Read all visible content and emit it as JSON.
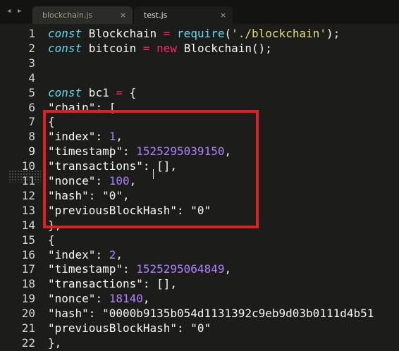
{
  "tabs": [
    {
      "label": "blockchain.js",
      "active": false,
      "close_icon": "×"
    },
    {
      "label": "test.js",
      "active": true,
      "close_icon": "×"
    }
  ],
  "nav": {
    "left_arrow": "◀",
    "right_arrow": "▶"
  },
  "line_numbers": [
    "1",
    "2",
    "3",
    "4",
    "5",
    "6",
    "7",
    "8",
    "9",
    "10",
    "11",
    "12",
    "13",
    "14",
    "15",
    "16",
    "17",
    "18",
    "19",
    "20",
    "21",
    "22"
  ],
  "active_line": 9,
  "code": {
    "l1": {
      "kw": "const",
      "name": " Blockchain ",
      "op": "=",
      "sp": " ",
      "fn": "require",
      "open": "(",
      "str": "'./blockchain'",
      "close": ");"
    },
    "l2": {
      "kw": "const",
      "name": " bitcoin ",
      "op": "=",
      "sp": " ",
      "new": "new",
      "rest": " Blockchain();"
    },
    "l5": {
      "kw": "const",
      "name": " bc1 ",
      "op": "=",
      "rest": " {"
    },
    "l6": {
      "key": "\"chain\"",
      "rest": ": ["
    },
    "l7": {
      "text": "{"
    },
    "l8": {
      "key": "\"index\"",
      "sep": ": ",
      "val": "1",
      "end": ","
    },
    "l9": {
      "key": "\"timestamp\"",
      "sep": ": ",
      "val": "1525295039150",
      "end": ","
    },
    "l10": {
      "key": "\"transactions\"",
      "rest": ": [],"
    },
    "l11": {
      "key": "\"nonce\"",
      "sep": ": ",
      "val": "100",
      "end": ","
    },
    "l12": {
      "key": "\"hash\"",
      "sep": ": ",
      "str": "\"0\"",
      "end": ","
    },
    "l13": {
      "key": "\"previousBlockHash\"",
      "sep": ": ",
      "str": "\"0\""
    },
    "l14": {
      "text": "},"
    },
    "l15": {
      "text": "{"
    },
    "l16": {
      "key": "\"index\"",
      "sep": ": ",
      "val": "2",
      "end": ","
    },
    "l17": {
      "key": "\"timestamp\"",
      "sep": ": ",
      "val": "1525295064849",
      "end": ","
    },
    "l18": {
      "key": "\"transactions\"",
      "rest": ": [],"
    },
    "l19": {
      "key": "\"nonce\"",
      "sep": ": ",
      "val": "18140",
      "end": ","
    },
    "l20": {
      "key": "\"hash\"",
      "sep": ": ",
      "str": "\"0000b9135b054d1131392c9eb9d03b0111d4b51"
    },
    "l21": {
      "key": "\"previousBlockHash\"",
      "sep": ": ",
      "str": "\"0\""
    },
    "l22": {
      "text": "},"
    }
  },
  "colors": {
    "background": "#1c1d1a",
    "keyword": "#66d9ef",
    "operator": "#f92672",
    "string": "#e6db74",
    "number": "#ae81ff",
    "highlight_box": "#e01f25"
  }
}
